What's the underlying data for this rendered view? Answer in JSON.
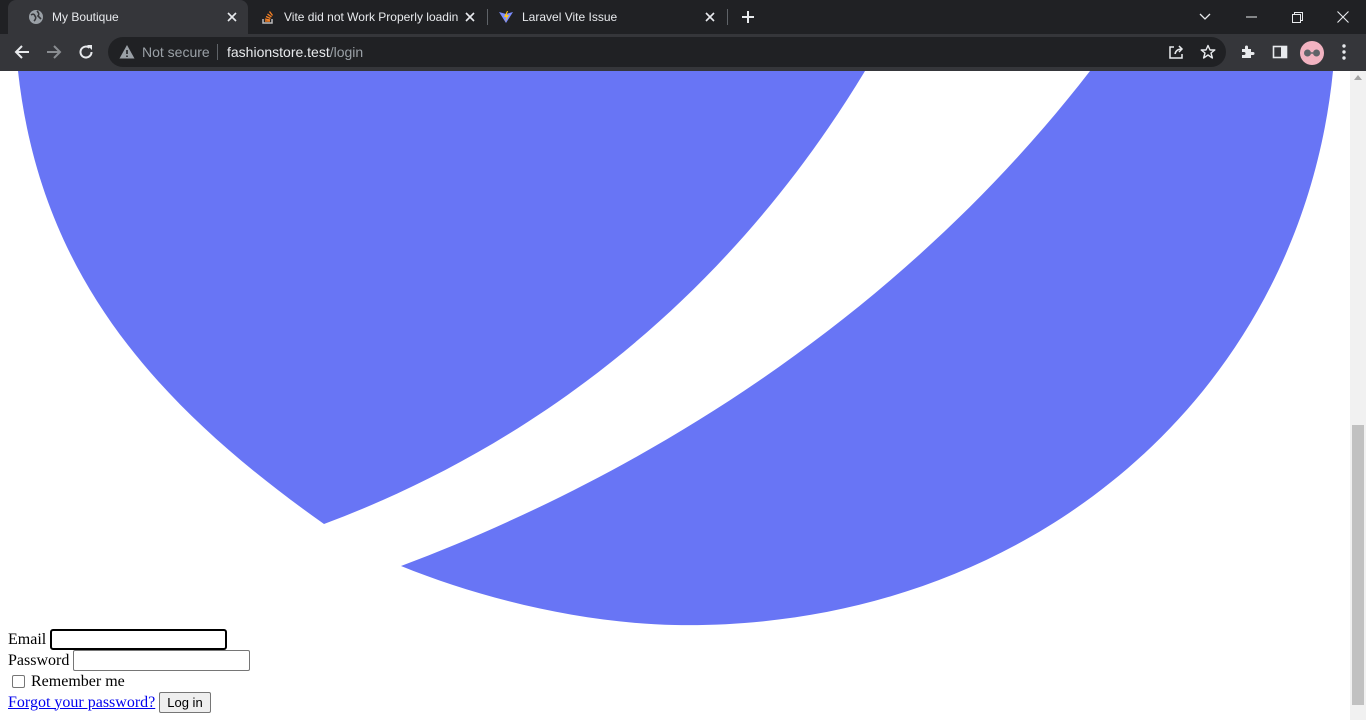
{
  "browser": {
    "tabs": [
      {
        "title": "My Boutique",
        "favicon": "globe-icon",
        "active": true
      },
      {
        "title": "Vite did not Work Properly loadin",
        "favicon": "stackoverflow-icon",
        "active": false
      },
      {
        "title": "Laravel Vite Issue",
        "favicon": "vite-icon",
        "active": false
      }
    ],
    "address_bar": {
      "security_label": "Not secure",
      "host": "fashionstore.test",
      "path": "/login"
    }
  },
  "page": {
    "logo": {
      "color": "#6875f5"
    },
    "form": {
      "email_label": "Email",
      "email_value": "",
      "password_label": "Password",
      "password_value": "",
      "remember_label": "Remember me",
      "remember_checked": false,
      "forgot_link": "Forgot your password?",
      "login_button": "Log in"
    }
  },
  "colors": {
    "chrome_dark": "#202124",
    "chrome_mid": "#35363a",
    "accent_logo": "#6875f5",
    "link": "#0000ee"
  }
}
